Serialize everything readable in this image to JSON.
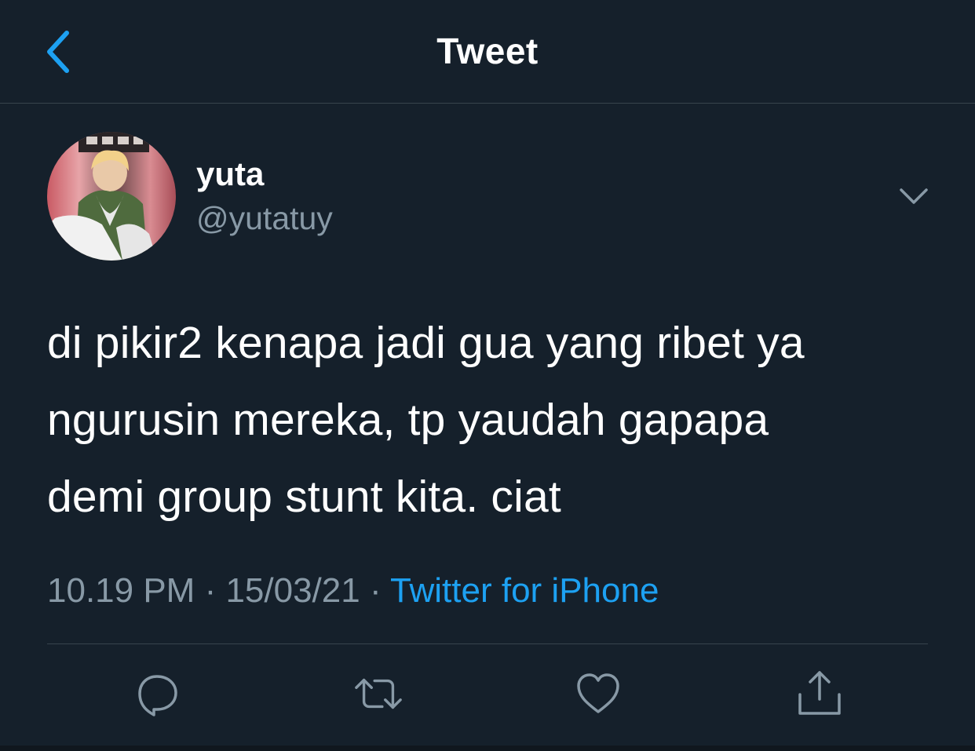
{
  "header": {
    "title": "Tweet",
    "back_icon": "chevron-left-icon"
  },
  "author": {
    "name": "yuta",
    "handle": "@yutatuy",
    "avatar": "avatar-photo"
  },
  "tweet": {
    "lines": [
      "di pikir2 kenapa jadi gua yang ribet ya",
      "ngurusin mereka, tp yaudah gapapa",
      "demi group stunt kita. ciat"
    ],
    "time": "10.19 PM",
    "separator": " · ",
    "date": "15/03/21",
    "source": "Twitter for iPhone"
  },
  "actions": {
    "reply_icon": "reply-icon",
    "retweet_icon": "retweet-icon",
    "like_icon": "heart-icon",
    "share_icon": "share-icon"
  },
  "colors": {
    "background": "#15202b",
    "accent": "#1da1f2",
    "secondary_text": "#8899a6",
    "divider": "#38444d"
  }
}
